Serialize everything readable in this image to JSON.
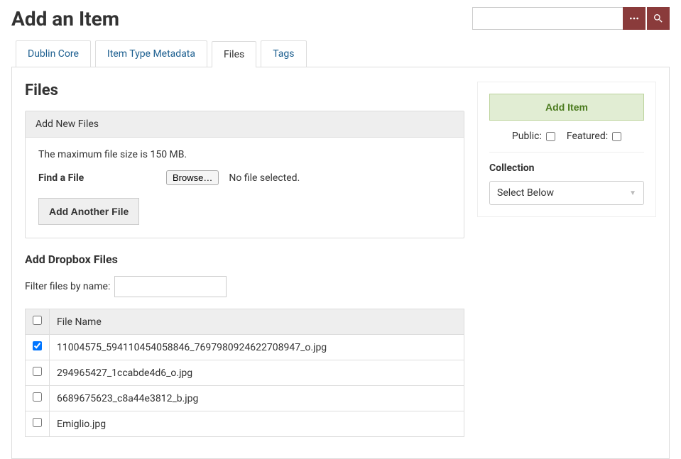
{
  "page": {
    "title": "Add an Item"
  },
  "tabs": [
    {
      "label": "Dublin Core"
    },
    {
      "label": "Item Type Metadata"
    },
    {
      "label": "Files"
    },
    {
      "label": "Tags"
    }
  ],
  "files": {
    "heading": "Files",
    "new_files": {
      "legend": "Add New Files",
      "hint": "The maximum file size is 150 MB.",
      "find_label": "Find a File",
      "browse_label": "Browse…",
      "no_file_text": "No file selected.",
      "add_another_label": "Add Another File"
    },
    "dropbox": {
      "heading": "Add Dropbox Files",
      "filter_label": "Filter files by name:",
      "table": {
        "header": "File Name",
        "rows": [
          {
            "checked": true,
            "name": "11004575_594110454058846_7697980924622708947_o.jpg"
          },
          {
            "checked": false,
            "name": "294965427_1ccabde4d6_o.jpg"
          },
          {
            "checked": false,
            "name": "6689675623_c8a44e3812_b.jpg"
          },
          {
            "checked": false,
            "name": "Emiglio.jpg"
          }
        ]
      }
    }
  },
  "sidebar": {
    "add_item_label": "Add Item",
    "public_label": "Public:",
    "featured_label": "Featured:",
    "collection_label": "Collection",
    "collection_value": "Select Below"
  }
}
